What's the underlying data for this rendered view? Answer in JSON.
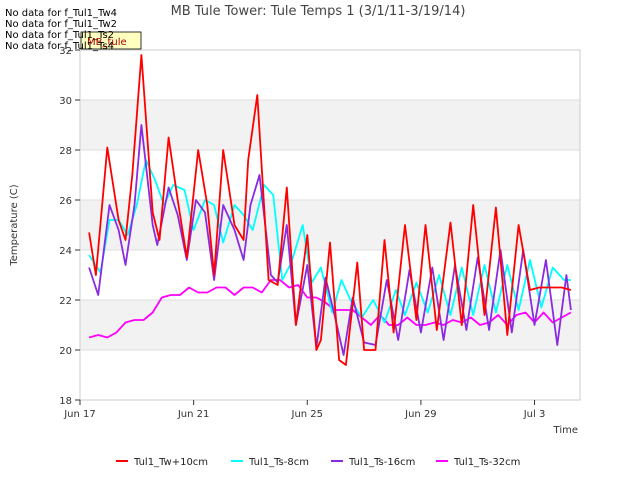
{
  "no_data_messages": [
    "No data for f_Tul1_Tw4",
    "No data for f_Tul1_Tw2",
    "No data for f_Tul1_Ts2",
    "No data for f_Tul1_Ts4"
  ],
  "chart_data": {
    "type": "line",
    "title": "MB Tule Tower: Tule Temps 1 (3/1/11-3/19/14)",
    "xlabel": "Time",
    "ylabel": "Temperature (C)",
    "site_badge": "MB_tule",
    "xlim": [
      0,
      22.0
    ],
    "ylim": [
      18,
      32
    ],
    "x_ticks": [
      {
        "x": 0,
        "label": "Jun 17"
      },
      {
        "x": 5,
        "label": "Jun 21"
      },
      {
        "x": 10,
        "label": "Jun 25"
      },
      {
        "x": 15,
        "label": "Jun 29"
      },
      {
        "x": 20,
        "label": "Jul 3"
      }
    ],
    "y_ticks": [
      18,
      20,
      22,
      24,
      26,
      28,
      30,
      32
    ],
    "grid_bands": [
      [
        20,
        22
      ],
      [
        24,
        26
      ],
      [
        28,
        30
      ]
    ],
    "legend_position": "bottom",
    "series": [
      {
        "name": "Tul1_Tw+10cm",
        "color": "#ff0000",
        "x": [
          0.4,
          0.7,
          1.2,
          1.7,
          2.0,
          2.3,
          2.7,
          3.2,
          3.5,
          3.9,
          4.3,
          4.7,
          5.2,
          5.6,
          5.9,
          6.3,
          6.8,
          7.2,
          7.4,
          7.8,
          8.3,
          8.7,
          9.1,
          9.5,
          10.0,
          10.4,
          10.6,
          11.0,
          11.4,
          11.7,
          12.2,
          12.5,
          13.0,
          13.4,
          13.8,
          14.3,
          14.8,
          15.2,
          15.7,
          16.3,
          16.8,
          17.3,
          17.8,
          18.3,
          18.8,
          19.3,
          19.8,
          20.2,
          20.6,
          21.2,
          21.6
        ],
        "y": [
          24.7,
          23.0,
          28.1,
          25.2,
          24.4,
          27.0,
          31.8,
          25.5,
          24.4,
          28.5,
          26.0,
          23.7,
          28.0,
          25.8,
          23.0,
          28.0,
          25.0,
          24.4,
          27.6,
          30.2,
          22.8,
          22.6,
          26.5,
          21.0,
          24.6,
          20.0,
          20.4,
          24.3,
          19.6,
          19.4,
          23.5,
          20.0,
          20.0,
          24.4,
          20.7,
          25.0,
          21.2,
          25.0,
          20.8,
          25.1,
          21.0,
          25.8,
          21.4,
          25.7,
          20.6,
          25.0,
          22.4,
          22.5,
          22.5,
          22.5,
          22.4
        ],
        "display_y": [
          24.7,
          23.0,
          28.1,
          25.2,
          24.4,
          27.0,
          31.8,
          25.5,
          24.4,
          28.5,
          26.0,
          23.7,
          28.0,
          25.8,
          23.0,
          28.0,
          25.0,
          24.4,
          27.6,
          30.2,
          22.8,
          22.6,
          26.5,
          21.0,
          24.6,
          20.0,
          20.4,
          24.3,
          19.6,
          19.4,
          23.5,
          20.0,
          20.0,
          24.4,
          20.7,
          25.0,
          21.2,
          25.0,
          20.8,
          25.1,
          21.0,
          25.8,
          21.4,
          25.7,
          20.6,
          25.0,
          22.4,
          22.5,
          22.5,
          22.5,
          22.4
        ]
      },
      {
        "name": "Tul1_Ts-8cm",
        "color": "#00ffff",
        "x": [
          0.4,
          0.9,
          1.3,
          1.7,
          2.1,
          2.5,
          2.9,
          3.3,
          3.7,
          4.1,
          4.6,
          5.0,
          5.5,
          5.9,
          6.3,
          6.8,
          7.2,
          7.6,
          8.1,
          8.5,
          8.9,
          9.3,
          9.8,
          10.2,
          10.6,
          11.1,
          11.5,
          11.9,
          12.4,
          12.9,
          13.4,
          13.9,
          14.3,
          14.8,
          15.3,
          15.8,
          16.3,
          16.8,
          17.3,
          17.8,
          18.3,
          18.8,
          19.3,
          19.8,
          20.3,
          20.8,
          21.3,
          21.6
        ],
        "y": [
          23.8,
          23.1,
          25.2,
          25.2,
          24.6,
          25.8,
          27.6,
          26.8,
          25.8,
          26.6,
          26.4,
          24.8,
          26.0,
          25.8,
          24.3,
          25.8,
          25.4,
          24.8,
          26.6,
          26.2,
          22.8,
          23.5,
          25.0,
          22.7,
          23.3,
          21.5,
          22.8,
          22.0,
          21.3,
          22.0,
          21.1,
          22.4,
          21.4,
          22.7,
          21.5,
          23.0,
          21.4,
          23.3,
          21.4,
          23.4,
          21.5,
          23.4,
          21.6,
          23.6,
          21.7,
          23.3,
          22.8,
          22.8
        ],
        "display_y": [
          23.8,
          23.1,
          25.2,
          25.2,
          24.6,
          25.8,
          27.6,
          26.8,
          25.8,
          26.6,
          26.4,
          24.8,
          26.0,
          25.8,
          24.3,
          25.8,
          25.4,
          24.8,
          26.6,
          26.2,
          22.8,
          23.5,
          25.0,
          22.7,
          23.3,
          21.5,
          22.8,
          22.0,
          21.3,
          22.0,
          21.1,
          22.4,
          21.4,
          22.7,
          21.5,
          23.0,
          21.4,
          23.3,
          21.4,
          23.4,
          21.5,
          23.4,
          21.6,
          23.6,
          21.7,
          23.3,
          22.8,
          22.8
        ]
      },
      {
        "name": "Tul1_Ts-16cm",
        "color": "#8a2be2",
        "x": [
          0.4,
          0.8,
          1.3,
          1.7,
          2.0,
          2.4,
          2.7,
          3.2,
          3.4,
          3.9,
          4.3,
          4.7,
          5.1,
          5.5,
          5.9,
          6.3,
          6.8,
          7.2,
          7.5,
          7.9,
          8.4,
          8.7,
          9.1,
          9.5,
          10.0,
          10.4,
          10.8,
          11.2,
          11.6,
          12.0,
          12.5,
          13.0,
          13.5,
          14.0,
          14.5,
          15.0,
          15.5,
          16.0,
          16.5,
          17.0,
          17.5,
          18.0,
          18.5,
          19.0,
          19.5,
          20.0,
          20.5,
          21.0,
          21.4,
          21.6
        ],
        "y": [
          23.3,
          22.2,
          25.8,
          24.8,
          23.4,
          25.8,
          29.0,
          25.0,
          24.2,
          26.5,
          25.4,
          23.6,
          26.0,
          25.5,
          22.8,
          25.8,
          24.8,
          23.6,
          25.8,
          27.0,
          23.0,
          22.7,
          25.0,
          21.0,
          23.4,
          20.1,
          22.9,
          21.4,
          19.8,
          22.1,
          20.3,
          20.2,
          22.8,
          20.4,
          23.2,
          20.7,
          23.3,
          20.4,
          23.4,
          20.8,
          23.7,
          20.8,
          24.0,
          20.7,
          24.0,
          21.0,
          23.6,
          20.2,
          23.0,
          21.6
        ],
        "display_y": [
          23.3,
          22.2,
          25.8,
          24.8,
          23.4,
          25.8,
          29.0,
          25.0,
          24.2,
          26.5,
          25.4,
          23.6,
          26.0,
          25.5,
          22.8,
          25.8,
          24.8,
          23.6,
          25.8,
          27.0,
          23.0,
          22.7,
          25.0,
          21.0,
          23.4,
          20.1,
          22.9,
          21.4,
          19.8,
          22.1,
          20.3,
          20.2,
          22.8,
          20.4,
          23.2,
          20.7,
          23.3,
          20.4,
          23.4,
          20.8,
          23.7,
          20.8,
          24.0,
          20.7,
          24.0,
          21.0,
          23.6,
          20.2,
          23.0,
          21.6
        ]
      },
      {
        "name": "Tul1_Ts-32cm",
        "color": "#ff00ff",
        "x": [
          0.4,
          0.8,
          1.2,
          1.6,
          2.0,
          2.4,
          2.8,
          3.2,
          3.6,
          4.0,
          4.4,
          4.8,
          5.2,
          5.6,
          6.0,
          6.4,
          6.8,
          7.2,
          7.6,
          8.0,
          8.4,
          8.8,
          9.2,
          9.6,
          10.0,
          10.4,
          10.8,
          11.2,
          11.6,
          12.0,
          12.4,
          12.8,
          13.2,
          13.6,
          14.0,
          14.4,
          14.8,
          15.2,
          15.6,
          16.0,
          16.4,
          16.8,
          17.2,
          17.6,
          18.0,
          18.4,
          18.8,
          19.2,
          19.6,
          20.0,
          20.4,
          20.8,
          21.2,
          21.6
        ],
        "y": [
          20.5,
          20.6,
          20.5,
          20.7,
          21.1,
          21.2,
          21.2,
          21.5,
          22.1,
          22.2,
          22.2,
          22.5,
          22.3,
          22.3,
          22.5,
          22.5,
          22.2,
          22.5,
          22.5,
          22.3,
          22.8,
          22.8,
          22.5,
          22.6,
          22.1,
          22.1,
          21.9,
          21.6,
          21.6,
          21.6,
          21.3,
          21.0,
          21.4,
          21.0,
          21.0,
          21.3,
          21.0,
          21.0,
          21.1,
          21.0,
          21.2,
          21.1,
          21.3,
          21.0,
          21.1,
          21.4,
          21.0,
          21.4,
          21.5,
          21.1,
          21.5,
          21.1,
          21.3,
          21.5
        ],
        "display_y": [
          20.5,
          20.6,
          20.5,
          20.7,
          21.1,
          21.2,
          21.2,
          21.5,
          22.1,
          22.2,
          22.2,
          22.5,
          22.3,
          22.3,
          22.5,
          22.5,
          22.2,
          22.5,
          22.5,
          22.3,
          22.8,
          22.8,
          22.5,
          22.6,
          22.1,
          22.1,
          21.9,
          21.6,
          21.6,
          21.6,
          21.3,
          21.0,
          21.4,
          21.0,
          21.0,
          21.3,
          21.0,
          21.0,
          21.1,
          21.0,
          21.2,
          21.1,
          21.3,
          21.0,
          21.1,
          21.4,
          21.0,
          21.4,
          21.5,
          21.1,
          21.5,
          21.1,
          21.3,
          21.5
        ]
      }
    ]
  }
}
